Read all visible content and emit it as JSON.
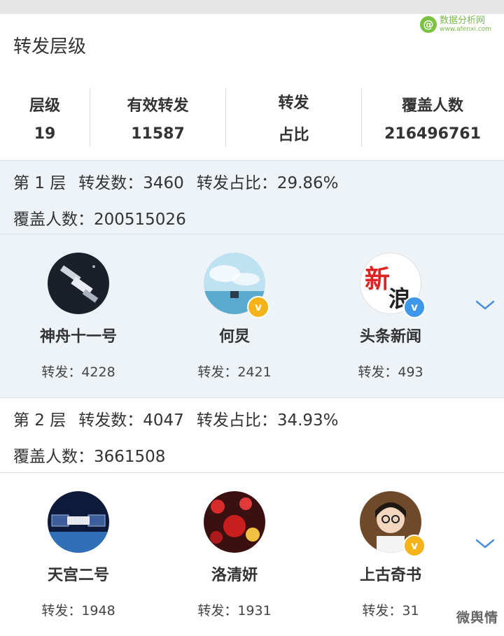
{
  "watermark": {
    "logo_letter": "@",
    "cn": "数据分析网",
    "en": "www.afenxi.com"
  },
  "page_title": "转发层级",
  "stats": [
    {
      "label": "层级",
      "value": "19"
    },
    {
      "label": "有效转发",
      "value": "11587"
    },
    {
      "label": "转发",
      "value": "占比"
    },
    {
      "label": "覆盖人数",
      "value": "216496761"
    }
  ],
  "layers": [
    {
      "head": "第 1 层",
      "forward_count": "转发数：3460",
      "forward_ratio": "转发占比：29.86%",
      "coverage": "覆盖人数：200515026",
      "users": [
        {
          "name": "神舟十一号",
          "forwards": "转发：4228",
          "badge": ""
        },
        {
          "name": "何炅",
          "forwards": "转发：2421",
          "badge": "gold-v"
        },
        {
          "name": "头条新闻",
          "forwards": "转发：493",
          "badge": "blue-v"
        }
      ]
    },
    {
      "head": "第 2 层",
      "forward_count": "转发数：4047",
      "forward_ratio": "转发占比：34.93%",
      "coverage": "覆盖人数：3661508",
      "users": [
        {
          "name": "天宫二号",
          "forwards": "转发：1948",
          "badge": ""
        },
        {
          "name": "洛清妍",
          "forwards": "转发：1931",
          "badge": ""
        },
        {
          "name": "上古奇书",
          "forwards": "转发：31",
          "badge": "gold-v"
        }
      ]
    }
  ],
  "avatar_text": {
    "news_1": "新",
    "news_2": "浪"
  },
  "badge_letter": "v",
  "footer_watermark": "微舆情",
  "colors": {
    "accent": "#4a90d9",
    "panel_bg": "#eef3f8",
    "gold_badge": "#f5b31a",
    "blue_badge": "#3e97e8"
  }
}
